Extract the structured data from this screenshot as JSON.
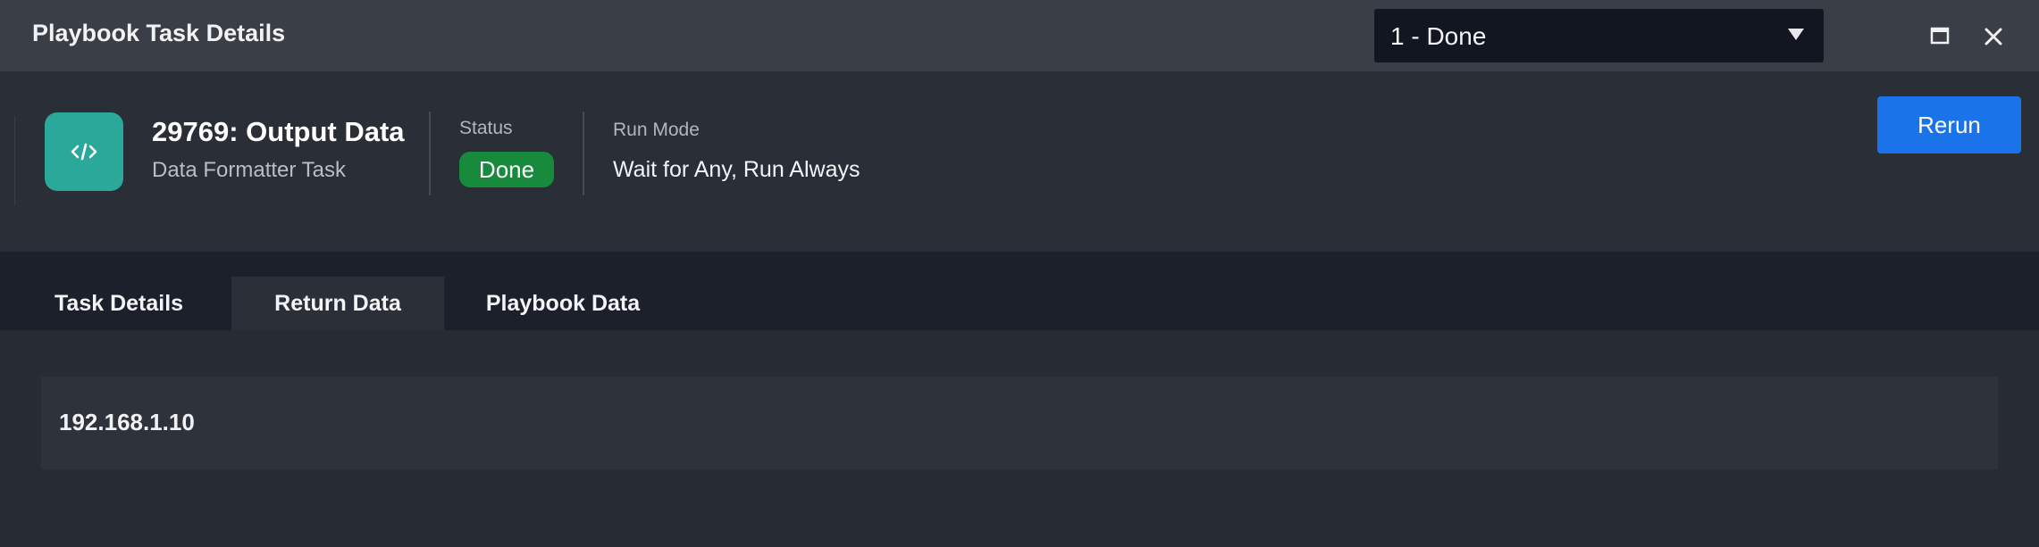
{
  "window": {
    "title": "Playbook Task Details",
    "run_selector": {
      "selected": "1 - Done"
    }
  },
  "task": {
    "name": "29769: Output Data",
    "type": "Data Formatter Task",
    "icon": "code-icon",
    "icon_color": "#2aa89a",
    "status_label": "Status",
    "status": "Done",
    "status_color": "#178a3b",
    "run_mode_label": "Run Mode",
    "run_mode": "Wait for Any, Run Always",
    "rerun_label": "Rerun",
    "accent": "#1a73e8"
  },
  "tabs": [
    {
      "label": "Task Details",
      "active": false
    },
    {
      "label": "Return Data",
      "active": true
    },
    {
      "label": "Playbook Data",
      "active": false
    }
  ],
  "return_data": {
    "value": "192.168.1.10"
  }
}
